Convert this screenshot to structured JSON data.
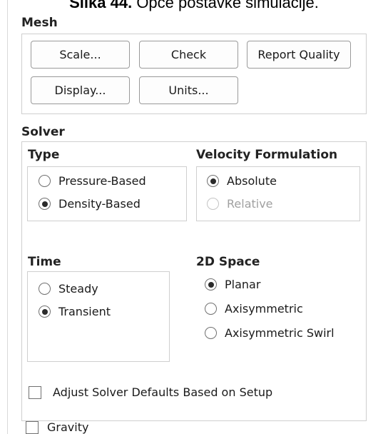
{
  "caption": {
    "bold": "Slika 44.",
    "text": " Opće postavke simulacije."
  },
  "mesh": {
    "title": "Mesh",
    "buttons": {
      "scale": "Scale...",
      "check": "Check",
      "report_quality": "Report Quality",
      "display": "Display...",
      "units": "Units..."
    }
  },
  "solver": {
    "title": "Solver",
    "type": {
      "title": "Type",
      "options": [
        {
          "label": "Pressure-Based",
          "selected": false
        },
        {
          "label": "Density-Based",
          "selected": true
        }
      ]
    },
    "velocity": {
      "title": "Velocity Formulation",
      "options": [
        {
          "label": "Absolute",
          "selected": true
        },
        {
          "label": "Relative",
          "selected": false,
          "disabled": true
        }
      ]
    },
    "time": {
      "title": "Time",
      "options": [
        {
          "label": "Steady",
          "selected": false
        },
        {
          "label": "Transient",
          "selected": true
        }
      ]
    },
    "space": {
      "title": "2D Space",
      "options": [
        {
          "label": "Planar",
          "selected": true
        },
        {
          "label": "Axisymmetric",
          "selected": false
        },
        {
          "label": "Axisymmetric Swirl",
          "selected": false
        }
      ]
    },
    "adjust_defaults": {
      "label": "Adjust Solver Defaults Based on Setup",
      "checked": false
    }
  },
  "gravity": {
    "label": "Gravity",
    "checked": false
  }
}
